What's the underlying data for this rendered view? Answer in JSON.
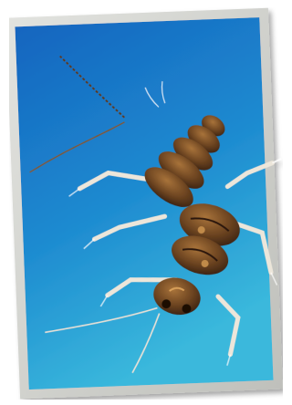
{
  "image": {
    "subject": "stonefly nymph",
    "subject_icon": "insect-icon",
    "colors": {
      "frame": "#cfd0cc",
      "sky_top": "#1a78cc",
      "sky_bottom": "#34b6dc",
      "body_dark": "#3a2212",
      "body_mid": "#6b4320",
      "body_light": "#a8733a",
      "legs": "#e8e2d6"
    }
  }
}
